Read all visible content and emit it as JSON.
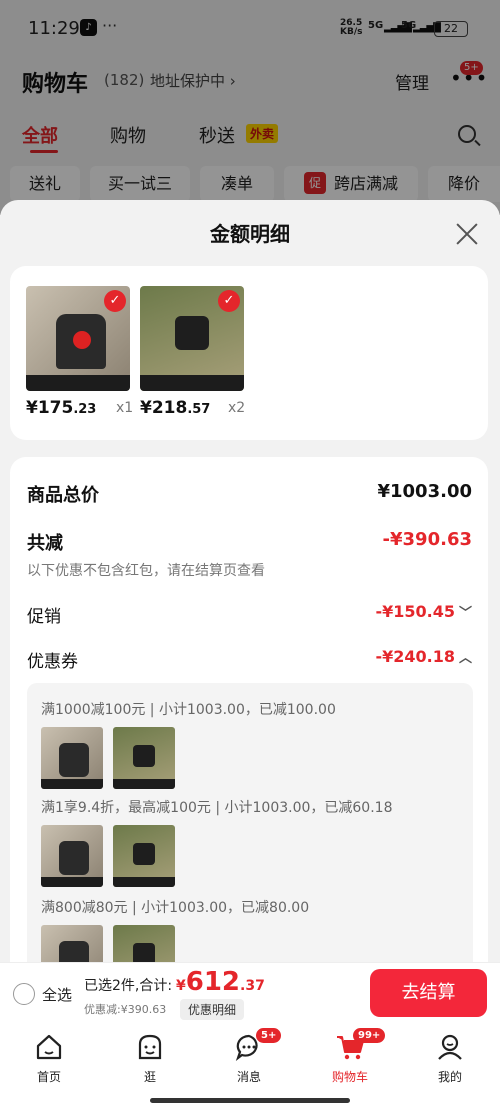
{
  "status_bar": {
    "time": "11:29",
    "tiktok": "♪",
    "dots": "···",
    "net_speed": "26.5",
    "net_unit": "KB/s",
    "sig1": "5G",
    "sig2": "5G",
    "battery": "22"
  },
  "header": {
    "title": "购物车",
    "count": "(182)",
    "address": "地址保护中 ›",
    "manage": "管理",
    "more": "•••",
    "badge": "5+"
  },
  "tabs": [
    {
      "label": "全部"
    },
    {
      "label": "购物"
    },
    {
      "label": "秒送"
    }
  ],
  "tabs_extra": {
    "waimai": "外卖"
  },
  "chips": [
    {
      "label": "送礼"
    },
    {
      "label": "买一试三"
    },
    {
      "label": "凑单"
    },
    {
      "label": "跨店满减",
      "icon": "促"
    },
    {
      "label": "降价"
    }
  ],
  "sheet": {
    "title": "金额明细",
    "products": [
      {
        "price_int": "¥175",
        "price_dec": ".23",
        "qty": "x1"
      },
      {
        "price_int": "¥218",
        "price_dec": ".57",
        "qty": "x2"
      }
    ],
    "total_label": "商品总价",
    "total_value": "¥1003.00",
    "reduce_label": "共减",
    "reduce_value": "-¥390.63",
    "reduce_note": "以下优惠不包含红包，请在结算页查看",
    "promo_label": "促销",
    "promo_value": "-¥150.45",
    "coupon_label": "优惠券",
    "coupon_value": "-¥240.18",
    "coupons": [
      {
        "text": "满1000减100元 | 小计1003.00，已减100.00"
      },
      {
        "text": "满1享9.4折，最高减100元 | 小计1003.00，已减60.18"
      },
      {
        "text": "满800减80元 | 小计1003.00，已减80.00"
      }
    ]
  },
  "bottom_bar": {
    "select_all": "全选",
    "summary": "已选2件,合计:",
    "total_cur": "¥",
    "total_int": "612",
    "total_dec": ".37",
    "reduce": "优惠减:¥390.63",
    "detail": "优惠明细",
    "checkout": "去结算"
  },
  "nav": [
    {
      "label": "首页",
      "icon": "home-icon"
    },
    {
      "label": "逛",
      "icon": "face-icon"
    },
    {
      "label": "消息",
      "icon": "message-icon",
      "badge": "5+"
    },
    {
      "label": "购物车",
      "icon": "cart-icon",
      "badge": "99+"
    },
    {
      "label": "我的",
      "icon": "profile-icon"
    }
  ],
  "colors": {
    "accent": "#e4262b",
    "checkout": "#f3273a"
  }
}
